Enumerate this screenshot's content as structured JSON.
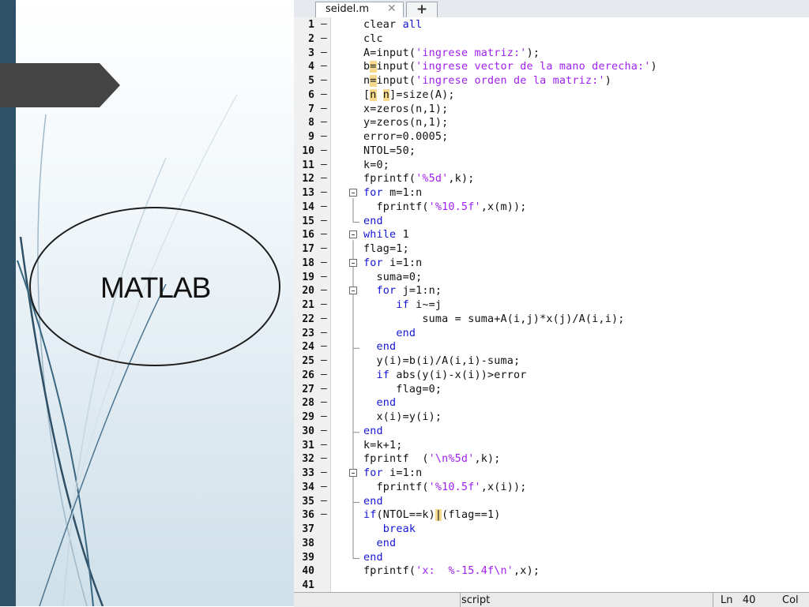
{
  "slide": {
    "title": "MATLAB"
  },
  "editor": {
    "tabs": [
      {
        "label": "seidel.m",
        "close_glyph": "✕"
      }
    ],
    "new_tab_glyph": "+",
    "lines": [
      {
        "n": "1",
        "segs": [
          [
            "",
            "clear "
          ],
          [
            "kw",
            "all"
          ]
        ]
      },
      {
        "n": "2",
        "segs": [
          [
            "",
            "clc"
          ]
        ]
      },
      {
        "n": "3",
        "segs": [
          [
            "",
            "A=input("
          ],
          [
            "str",
            "'ingrese matriz:'"
          ],
          [
            "",
            ");"
          ]
        ]
      },
      {
        "n": "4",
        "segs": [
          [
            "",
            "b"
          ],
          [
            "hl",
            "="
          ],
          [
            "",
            "input("
          ],
          [
            "str",
            "'ingrese vector de la mano derecha:'"
          ],
          [
            "",
            ")"
          ]
        ]
      },
      {
        "n": "5",
        "segs": [
          [
            "",
            "n"
          ],
          [
            "hl",
            "="
          ],
          [
            "",
            "input("
          ],
          [
            "str",
            "'ingrese orden de la matriz:'"
          ],
          [
            "",
            ")"
          ]
        ]
      },
      {
        "n": "6",
        "segs": [
          [
            "",
            "["
          ],
          [
            "hl",
            "n"
          ],
          [
            "",
            " "
          ],
          [
            "hl",
            "n"
          ],
          [
            "",
            "]=size(A);"
          ]
        ]
      },
      {
        "n": "7",
        "segs": [
          [
            "",
            "x=zeros(n,1);"
          ]
        ]
      },
      {
        "n": "8",
        "segs": [
          [
            "",
            "y=zeros(n,1);"
          ]
        ]
      },
      {
        "n": "9",
        "segs": [
          [
            "",
            "error=0.0005;"
          ]
        ]
      },
      {
        "n": "10",
        "segs": [
          [
            "",
            "NTOL=50;"
          ]
        ]
      },
      {
        "n": "11",
        "segs": [
          [
            "",
            "k=0;"
          ]
        ]
      },
      {
        "n": "12",
        "segs": [
          [
            "",
            "fprintf("
          ],
          [
            "str",
            "'%5d'"
          ],
          [
            "",
            ",k);"
          ]
        ]
      },
      {
        "n": "13",
        "segs": [
          [
            "kw",
            "for "
          ],
          [
            "",
            "m=1:n"
          ]
        ]
      },
      {
        "n": "14",
        "segs": [
          [
            "",
            "  fprintf("
          ],
          [
            "str",
            "'%10.5f'"
          ],
          [
            "",
            ",x(m));"
          ]
        ]
      },
      {
        "n": "15",
        "segs": [
          [
            "kw",
            "end"
          ]
        ]
      },
      {
        "n": "16",
        "segs": [
          [
            "kw",
            "while "
          ],
          [
            "",
            "1"
          ]
        ]
      },
      {
        "n": "17",
        "segs": [
          [
            "",
            "flag=1;"
          ]
        ]
      },
      {
        "n": "18",
        "segs": [
          [
            "kw",
            "for "
          ],
          [
            "",
            "i=1:n"
          ]
        ]
      },
      {
        "n": "19",
        "segs": [
          [
            "",
            "  suma=0;"
          ]
        ]
      },
      {
        "n": "20",
        "segs": [
          [
            "",
            "  "
          ],
          [
            "kw",
            "for "
          ],
          [
            "",
            "j=1:n;"
          ]
        ]
      },
      {
        "n": "21",
        "segs": [
          [
            "",
            "     "
          ],
          [
            "kw",
            "if "
          ],
          [
            "",
            "i~=j"
          ]
        ]
      },
      {
        "n": "22",
        "segs": [
          [
            "",
            "         suma = suma+A(i,j)*x(j)/A(i,i);"
          ]
        ]
      },
      {
        "n": "23",
        "segs": [
          [
            "",
            "     "
          ],
          [
            "kw",
            "end"
          ]
        ]
      },
      {
        "n": "24",
        "segs": [
          [
            "",
            "  "
          ],
          [
            "kw",
            "end"
          ]
        ]
      },
      {
        "n": "25",
        "segs": [
          [
            "",
            "  y(i)=b(i)/A(i,i)-suma;"
          ]
        ]
      },
      {
        "n": "26",
        "segs": [
          [
            "",
            "  "
          ],
          [
            "kw",
            "if "
          ],
          [
            "",
            "abs(y(i)-x(i))>error"
          ]
        ]
      },
      {
        "n": "27",
        "segs": [
          [
            "",
            "     flag=0;"
          ]
        ]
      },
      {
        "n": "28",
        "segs": [
          [
            "",
            "  "
          ],
          [
            "kw",
            "end"
          ]
        ]
      },
      {
        "n": "29",
        "segs": [
          [
            "",
            "  x(i)=y(i);"
          ]
        ]
      },
      {
        "n": "30",
        "segs": [
          [
            "kw",
            "end"
          ]
        ]
      },
      {
        "n": "31",
        "segs": [
          [
            "",
            "k=k+1;"
          ]
        ]
      },
      {
        "n": "32",
        "segs": [
          [
            "",
            "fprintf  ("
          ],
          [
            "str",
            "'\\n%5d'"
          ],
          [
            "",
            ",k);"
          ]
        ]
      },
      {
        "n": "33",
        "segs": [
          [
            "kw",
            "for "
          ],
          [
            "",
            "i=1:n"
          ]
        ]
      },
      {
        "n": "34",
        "segs": [
          [
            "",
            "  fprintf("
          ],
          [
            "str",
            "'%10.5f'"
          ],
          [
            "",
            ",x(i));"
          ]
        ]
      },
      {
        "n": "35",
        "segs": [
          [
            "kw",
            "end"
          ]
        ]
      },
      {
        "n": "36",
        "segs": [
          [
            "kw",
            "if"
          ],
          [
            "",
            "(NTOL==k)"
          ],
          [
            "hl",
            "|"
          ],
          [
            "",
            "(flag==1)"
          ]
        ]
      },
      {
        "n": "37",
        "segs": [
          [
            "",
            "   "
          ],
          [
            "kw",
            "break"
          ]
        ]
      },
      {
        "n": "38",
        "segs": [
          [
            "",
            "  "
          ],
          [
            "kw",
            "end"
          ]
        ]
      },
      {
        "n": "39",
        "segs": [
          [
            "kw",
            "end"
          ]
        ]
      },
      {
        "n": "40",
        "segs": [
          [
            "",
            "fprintf("
          ],
          [
            "str",
            "'x:  %-15.4f\\n'"
          ],
          [
            "",
            ",x);"
          ]
        ]
      },
      {
        "n": "41",
        "segs": []
      }
    ],
    "dash_lines": [
      "1",
      "2",
      "3",
      "4",
      "5",
      "6",
      "7",
      "8",
      "9",
      "10",
      "11",
      "12",
      "13",
      "14",
      "15",
      "16",
      "17",
      "18",
      "19",
      "20",
      "21",
      "22",
      "23",
      "24",
      "25",
      "26",
      "27",
      "28",
      "29",
      "30",
      "31",
      "32",
      "33",
      "34",
      "35",
      "36"
    ],
    "fold_lines": [
      "13",
      "16",
      "18",
      "20",
      "33"
    ]
  },
  "statusbar": {
    "mode": "script",
    "ln_label": "Ln",
    "ln_value": "40",
    "col_label": "Col"
  },
  "colors": {
    "keyword": "#1515d6",
    "string": "#a020f0",
    "highlight": "#f5d98c",
    "sidebar": "#2f5168"
  }
}
